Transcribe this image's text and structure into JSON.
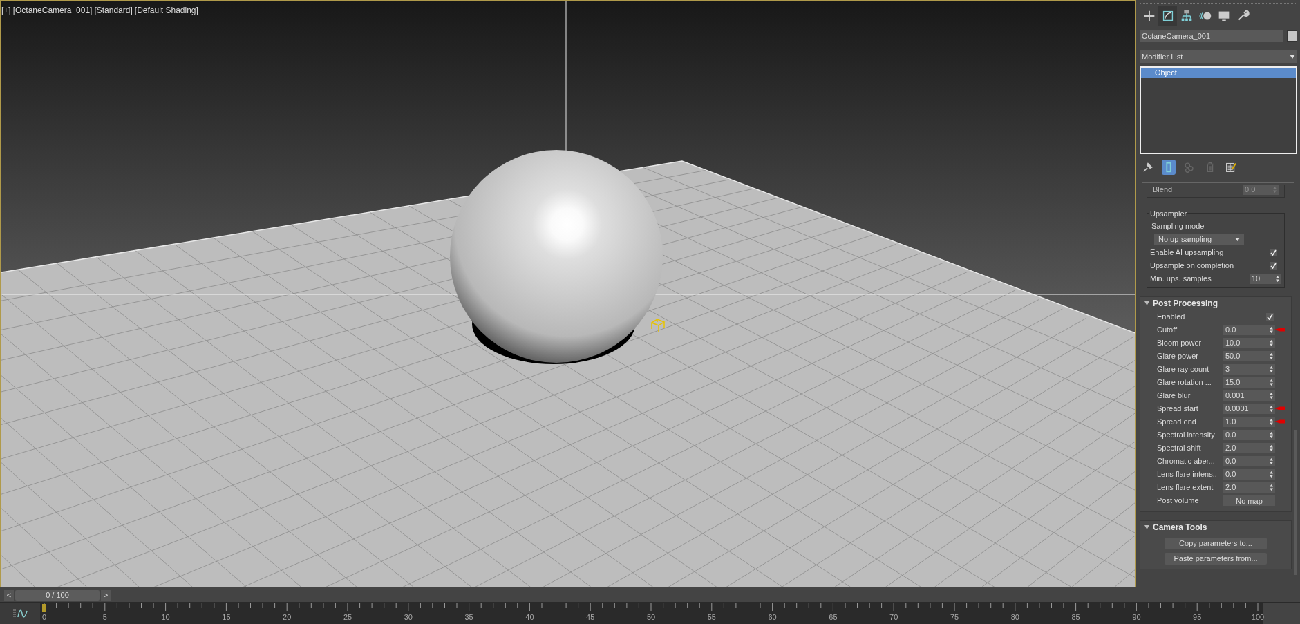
{
  "viewport": {
    "labels": [
      "[+]",
      "[OctaneCamera_001]",
      "[Standard]",
      "[Default Shading]"
    ]
  },
  "command_panel": {
    "tabs": [
      {
        "kind": "create",
        "selected": false
      },
      {
        "kind": "modify",
        "selected": true
      },
      {
        "kind": "hierarchy",
        "selected": false
      },
      {
        "kind": "motion",
        "selected": false
      },
      {
        "kind": "display",
        "selected": false
      },
      {
        "kind": "utilities",
        "selected": false
      }
    ],
    "object_name": "OctaneCamera_001",
    "modifier_list": "Modifier List",
    "stack": [
      {
        "label": "Object",
        "selected": true
      }
    ],
    "stack_tools": [
      {
        "kind": "pin",
        "active": false,
        "disabled": false
      },
      {
        "kind": "show-end-result",
        "active": true,
        "disabled": false
      },
      {
        "kind": "make-unique",
        "active": false,
        "disabled": true
      },
      {
        "kind": "remove",
        "active": false,
        "disabled": true
      },
      {
        "kind": "configure",
        "active": false,
        "disabled": false
      }
    ],
    "partial_row": {
      "label": "Blend",
      "value": "0.0",
      "disabled": true
    },
    "upsampler": {
      "title": "Upsampler",
      "mode_label": "Sampling mode",
      "mode": "No up-sampling",
      "rows": [
        {
          "kind": "checkbox",
          "label": "Enable AI upsampling",
          "checked": true
        },
        {
          "kind": "checkbox",
          "label": "Upsample on completion",
          "checked": true
        },
        {
          "kind": "spinner",
          "label": "Min. ups. samples",
          "value": "10"
        }
      ]
    },
    "rollouts": [
      {
        "title": "Post Processing",
        "expanded": true,
        "rows": [
          {
            "kind": "checkbox",
            "label": "Enabled",
            "checked": true,
            "marked": false
          },
          {
            "kind": "spinner",
            "label": "Cutoff",
            "value": "0.0",
            "marked": true
          },
          {
            "kind": "spinner",
            "label": "Bloom power",
            "value": "10.0",
            "marked": false
          },
          {
            "kind": "spinner",
            "label": "Glare power",
            "value": "50.0",
            "marked": false
          },
          {
            "kind": "spinner",
            "label": "Glare ray count",
            "value": "3",
            "marked": false
          },
          {
            "kind": "spinner",
            "label": "Glare rotation ...",
            "value": "15.0",
            "marked": false
          },
          {
            "kind": "spinner",
            "label": "Glare blur",
            "value": "0.001",
            "marked": false
          },
          {
            "kind": "spinner",
            "label": "Spread start",
            "value": "0.0001",
            "marked": true
          },
          {
            "kind": "spinner",
            "label": "Spread end",
            "value": "1.0",
            "marked": true
          },
          {
            "kind": "spinner",
            "label": "Spectral intensity",
            "value": "0.0",
            "marked": false
          },
          {
            "kind": "spinner",
            "label": "Spectral shift",
            "value": "2.0",
            "marked": false
          },
          {
            "kind": "spinner",
            "label": "Chromatic aber...",
            "value": "0.0",
            "marked": false
          },
          {
            "kind": "spinner",
            "label": "Lens flare intens..",
            "value": "0.0",
            "marked": false
          },
          {
            "kind": "spinner",
            "label": "Lens flare extent",
            "value": "2.0",
            "marked": false
          },
          {
            "kind": "map",
            "label": "Post volume",
            "value": "No map",
            "marked": false
          }
        ]
      },
      {
        "title": "Camera Tools",
        "expanded": true,
        "buttons": [
          "Copy parameters to...",
          "Paste parameters from..."
        ]
      }
    ]
  },
  "timeline": {
    "prev": "<",
    "frame": "0 / 100",
    "next": ">",
    "tick_labels": [
      "0",
      "5",
      "10",
      "15",
      "20",
      "25",
      "30",
      "35",
      "40",
      "45",
      "50",
      "55",
      "60",
      "65",
      "70",
      "75",
      "80",
      "85",
      "90",
      "95",
      "100"
    ]
  }
}
